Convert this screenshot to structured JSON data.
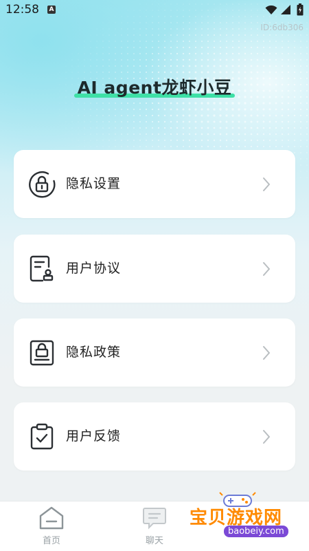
{
  "status_bar": {
    "time": "12:58",
    "notification_glyph": "A",
    "icons": [
      "wifi-icon",
      "signal-icon",
      "battery-icon"
    ]
  },
  "device_id": "ID:6db306",
  "app_title": "AI agent龙虾小豆",
  "colors": {
    "title_underline": "#3ee0a6",
    "card_bg": "#ffffff",
    "icon_stroke": "#2b2f33",
    "watermark_orange": "#ff8a00",
    "watermark_purple": "#7b49d6"
  },
  "menu": [
    {
      "label": "隐私设置",
      "icon": "lock-circle-icon"
    },
    {
      "label": "用户协议",
      "icon": "agreement-icon"
    },
    {
      "label": "隐私政策",
      "icon": "policy-lock-icon"
    },
    {
      "label": "用户反馈",
      "icon": "clipboard-check-icon"
    }
  ],
  "bottom_nav": [
    {
      "label": "首页",
      "icon": "home-icon"
    },
    {
      "label": "聊天",
      "icon": "chat-icon"
    }
  ],
  "watermark": {
    "text": "宝贝游戏网",
    "url": "baobeiy.com"
  }
}
